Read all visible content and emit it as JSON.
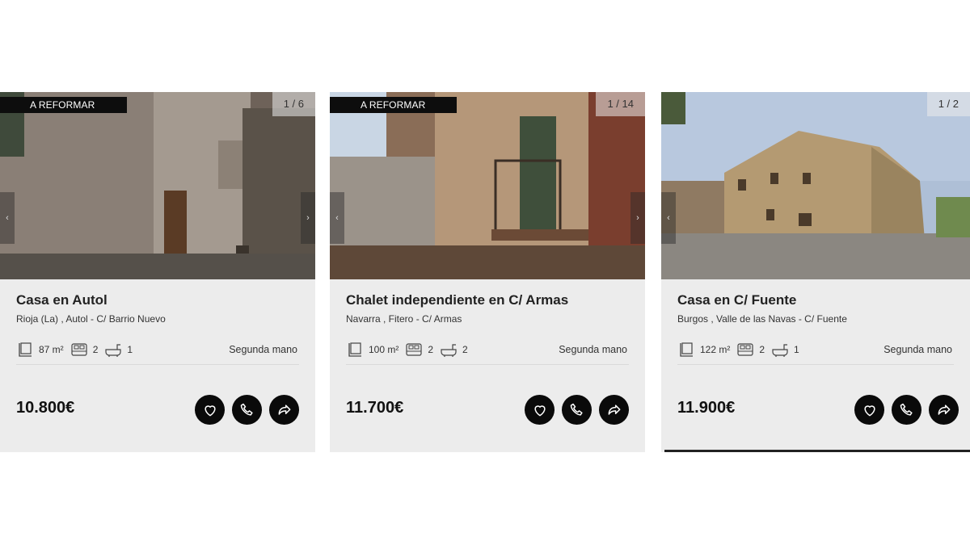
{
  "listings": [
    {
      "badge": "A REFORMAR",
      "photo_counter": "1 / 6",
      "title": "Casa en Autol",
      "location": "Rioja (La) , Autol - C/ Barrio Nuevo",
      "area": "87 m²",
      "bedrooms": "2",
      "bathrooms": "1",
      "condition": "Segunda mano",
      "price": "10.800€"
    },
    {
      "badge": "A REFORMAR",
      "photo_counter": "1 / 14",
      "title": "Chalet independiente en C/ Armas",
      "location": "Navarra , Fitero - C/ Armas",
      "area": "100 m²",
      "bedrooms": "2",
      "bathrooms": "2",
      "condition": "Segunda mano",
      "price": "11.700€"
    },
    {
      "badge": "",
      "photo_counter": "1 / 2",
      "title": "Casa en C/ Fuente",
      "location": "Burgos , Valle de las Navas - C/ Fuente",
      "area": "122 m²",
      "bedrooms": "2",
      "bathrooms": "1",
      "condition": "Segunda mano",
      "price": "11.900€"
    }
  ],
  "icons": {
    "area": "area-icon",
    "bedrooms": "bed-icon",
    "bathrooms": "bathtub-icon",
    "favorite": "heart-icon",
    "call": "phone-icon",
    "share": "share-icon",
    "prev": "chevron-left-icon",
    "next": "chevron-right-icon"
  },
  "colors": {
    "card_bg": "#ececec",
    "badge_bg": "#0d0d0d",
    "button_bg": "#0a0a0a"
  }
}
